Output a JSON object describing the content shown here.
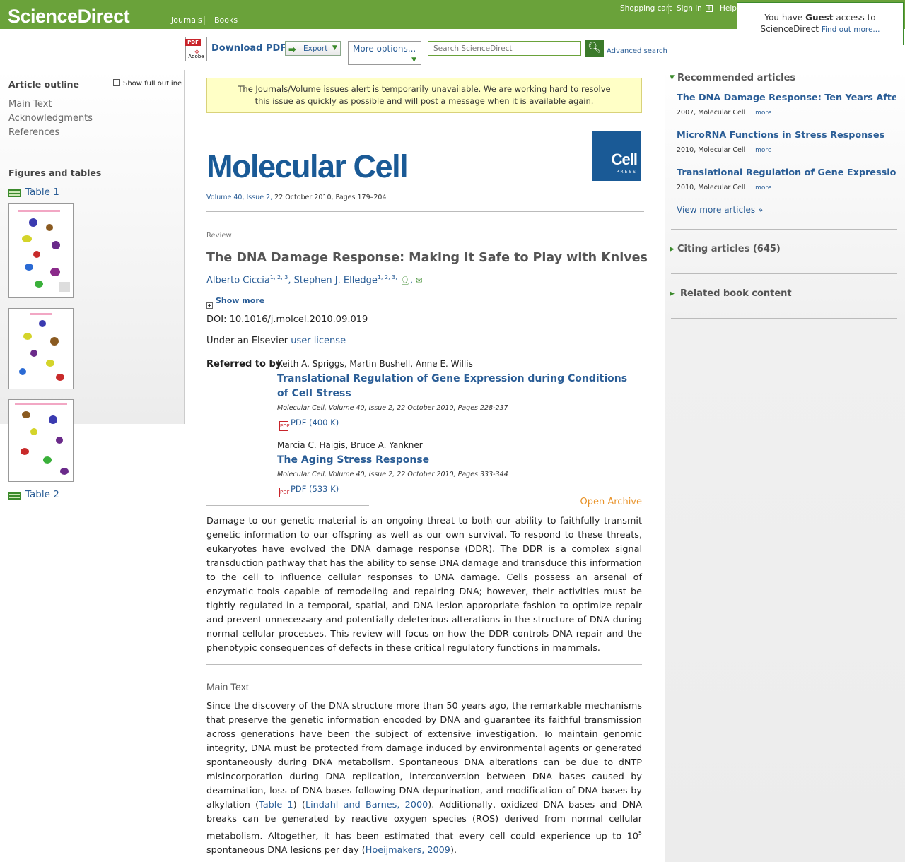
{
  "header": {
    "logo": "ScienceDirect",
    "nav": [
      "Journals",
      "Books"
    ],
    "links": [
      "Shopping cart",
      "Sign in",
      "Help"
    ],
    "guest_box": {
      "line1_pre": "You have ",
      "line1_bold": "Guest",
      "line1_post": " access to",
      "line2": "ScienceDirect",
      "find_out": "Find out more..."
    }
  },
  "toolbar": {
    "download_pdf": "Download PDF",
    "pdf_icon_tag": "PDF",
    "pdf_icon_label": "Adobe",
    "export": "Export",
    "more_options": "More options...",
    "search_placeholder": "Search ScienceDirect",
    "advanced_search": "Advanced search"
  },
  "left_sidebar": {
    "outline_title": "Article outline",
    "show_full_outline": "Show full outline",
    "outline_items": [
      "Main Text",
      "Acknowledgments",
      "References"
    ],
    "figures_title": "Figures and tables",
    "table1": "Table 1",
    "table2": "Table 2"
  },
  "alert": {
    "text": "The Journals/Volume issues alert is temporarily unavailable. We are working hard to resolve this issue as quickly as possible and will post a message when it is available again."
  },
  "journal": {
    "title": "Molecular Cell",
    "logo_top": "Cell",
    "logo_bottom": "PRESS",
    "volume_link": "Volume 40, Issue 2,",
    "citation_rest": " 22 October 2010, Pages 179–204"
  },
  "article": {
    "type": "Review",
    "title": "The DNA Damage Response: Making It Safe to Play with Knives",
    "author1": "Alberto Ciccia",
    "author1_sup": "1, 2, 3",
    "author2": "Stephen J. Elledge",
    "author2_sup": "1, 2, 3,",
    "show_more": "Show more",
    "doi": "DOI:  10.1016/j.molcel.2010.09.019",
    "license_pre": "Under an Elsevier ",
    "license_link": "user license",
    "referred_by": "Referred to by",
    "refs": [
      {
        "authors": "Keith A. Spriggs, Martin Bushell, Anne E. Willis",
        "title": "Translational Regulation of Gene Expression during Conditions of Cell Stress",
        "cite": "Molecular Cell, Volume 40, Issue 2, 22 October 2010, Pages 228-237",
        "pdf": "PDF (400 K)"
      },
      {
        "authors": "Marcia C. Haigis, Bruce A. Yankner",
        "title": "The Aging Stress Response",
        "cite": "Molecular Cell, Volume 40, Issue 2, 22 October 2010, Pages 333-344",
        "pdf": "PDF (533 K)"
      }
    ],
    "open_archive": "Open Archive",
    "abstract": "Damage to our genetic material is an ongoing threat to both our ability to faithfully transmit genetic information to our offspring as well as our own survival. To respond to these threats, eukaryotes have evolved the DNA damage response (DDR). The DDR is a complex signal transduction pathway that has the ability to sense DNA damage and transduce this information to the cell to influence cellular responses to DNA damage. Cells possess an arsenal of enzymatic tools capable of remodeling and repairing DNA; however, their activities must be tightly regulated in a temporal, spatial, and DNA lesion-appropriate fashion to optimize repair and prevent unnecessary and potentially deleterious alterations in the structure of DNA during normal cellular processes. This review will focus on how the DDR controls DNA repair and the phenotypic consequences of defects in these critical regulatory functions in mammals.",
    "main_text_heading": "Main Text",
    "main_text_1": "Since the discovery of the DNA structure more than 50 years ago, the remarkable mechanisms that preserve the genetic information encoded by DNA and guarantee its faithful transmission across generations have been the subject of extensive investigation. To maintain genomic integrity, DNA must be protected from damage induced by environmental agents or generated spontaneously during DNA metabolism. Spontaneous DNA alterations can be due to dNTP misincorporation during DNA replication, interconversion between DNA bases caused by deamination, loss of DNA bases following DNA depurination, and modification of DNA bases by alkylation (",
    "main_text_link1": "Table 1",
    "main_text_2": ") (",
    "main_text_link2": "Lindahl and Barnes, 2000",
    "main_text_3": "). Additionally, oxidized DNA bases and DNA breaks can be generated by reactive oxygen species (ROS) derived from normal cellular metabolism. Altogether, it has been estimated that every cell could experience up to 10",
    "main_text_sup": "5",
    "main_text_4": " spontaneous DNA lesions per day (",
    "main_text_link3": "Hoeijmakers, 2009",
    "main_text_5": ")."
  },
  "right_sidebar": {
    "recommended_title": "Recommended articles",
    "recommended": [
      {
        "title": "The DNA Damage Response: Ten Years After",
        "meta": "2007, Molecular Cell",
        "more": "more"
      },
      {
        "title": "MicroRNA Functions in Stress Responses",
        "meta": "2010, Molecular Cell",
        "more": "more"
      },
      {
        "title": "Translational Regulation of Gene Expression du..",
        "meta": "2010, Molecular Cell",
        "more": "more"
      }
    ],
    "view_more": "View more articles »",
    "citing_title": "Citing articles (645)",
    "related_title": "Related book content"
  }
}
